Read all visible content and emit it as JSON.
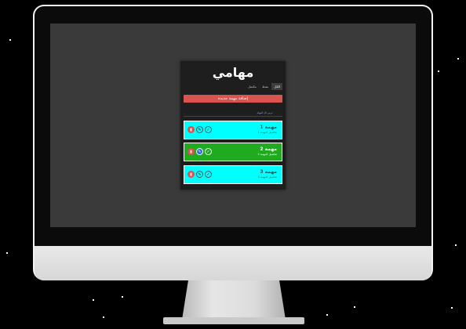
{
  "app": {
    "title": "مهامي",
    "tabs": [
      "الكل",
      "نشط",
      "مكتمل"
    ],
    "add_button": "إضافة مهمة جديدة",
    "filter_label": "عرض كل المهام"
  },
  "tasks": [
    {
      "title": "مهمة 1",
      "subtitle": "تفاصيل المهمة 1",
      "status": "active",
      "color": "#00ffff"
    },
    {
      "title": "مهمة 2",
      "subtitle": "تفاصيل المهمة 2",
      "status": "completed",
      "color": "#1faa1f"
    },
    {
      "title": "مهمة 3",
      "subtitle": "تفاصيل المهمة 3",
      "status": "active",
      "color": "#00ffff"
    }
  ],
  "icons": {
    "delete": "trash-icon",
    "edit": "pencil-icon",
    "done": "check-icon"
  }
}
